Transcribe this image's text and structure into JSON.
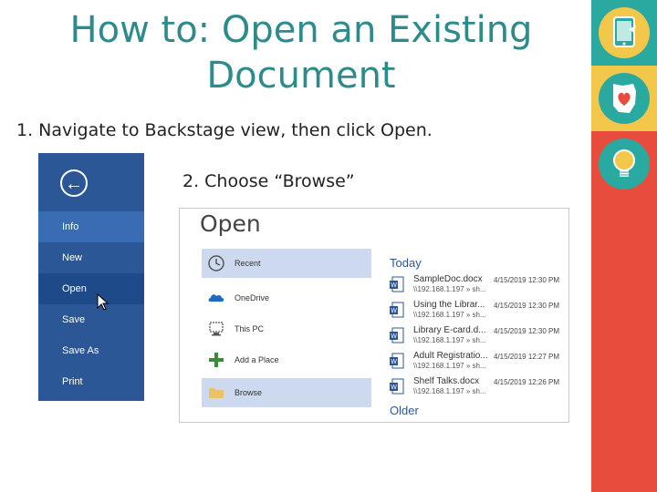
{
  "slide": {
    "title_line1": "How to: Open an Existing",
    "title_line2": "Document",
    "step1": "1.  Navigate to Backstage view, then click Open.",
    "step2": "2.  Choose “Browse”"
  },
  "colors": {
    "accent": "#2e8b8b",
    "backstage": "#2b5797",
    "rail": "#e74c3c"
  },
  "backstage": {
    "back_icon": "←",
    "items": [
      {
        "label": "Info"
      },
      {
        "label": "New"
      },
      {
        "label": "Open"
      },
      {
        "label": "Save"
      },
      {
        "label": "Save As"
      },
      {
        "label": "Print"
      }
    ]
  },
  "open_dialog": {
    "title": "Open",
    "locations": [
      {
        "label": "Recent",
        "icon": "clock-icon"
      },
      {
        "label": "OneDrive",
        "icon": "cloud-icon"
      },
      {
        "label": "This PC",
        "icon": "computer-icon"
      },
      {
        "label": "Add a Place",
        "icon": "plus-icon"
      },
      {
        "label": "Browse",
        "icon": "folder-icon"
      }
    ],
    "section_today": "Today",
    "section_older": "Older",
    "files": [
      {
        "name": "SampleDoc.docx",
        "path": "\\\\192.168.1.197 » sh...",
        "date": "4/15/2019 12:30 PM"
      },
      {
        "name": "Using the Librar...",
        "path": "\\\\192.168.1.197 » sh...",
        "date": "4/15/2019 12:30 PM"
      },
      {
        "name": "Library E-card.d...",
        "path": "\\\\192.168.1.197 » sh...",
        "date": "4/15/2019 12:30 PM"
      },
      {
        "name": "Adult Registratio...",
        "path": "\\\\192.168.1.197 » sh...",
        "date": "4/15/2019 12:27 PM"
      },
      {
        "name": "Shelf Talks.docx",
        "path": "\\\\192.168.1.197 » sh...",
        "date": "4/15/2019 12:26 PM"
      }
    ]
  }
}
